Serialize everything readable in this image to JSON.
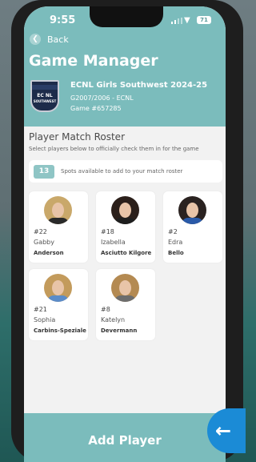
{
  "status": {
    "time": "9:55",
    "battery": "71"
  },
  "nav": {
    "back_label": "Back"
  },
  "page": {
    "title": "Game Manager"
  },
  "game": {
    "name": "ECNL Girls Southwest 2024-25",
    "division": "G2007/2006 - ECNL",
    "number": "Game #657285",
    "crest_text": "EC SOUTHWEST"
  },
  "roster": {
    "title": "Player Match Roster",
    "subtitle": "Select players below to officially check them in for the game",
    "spots_count": "13",
    "spots_text": "Spots available to add to your match roster"
  },
  "players": [
    {
      "number": "#22",
      "first": "Gabby",
      "last": "Anderson",
      "hair": "#c9a86a",
      "shirt": "#2a2a2a"
    },
    {
      "number": "#18",
      "first": "Izabella",
      "last": "Asciutto Kilgore",
      "hair": "#2b1f1a",
      "shirt": "#1e1e1e"
    },
    {
      "number": "#2",
      "first": "Edra",
      "last": "Bello",
      "hair": "#2a2220",
      "shirt": "#2a5aa8"
    },
    {
      "number": "#21",
      "first": "Sophia",
      "last": "Carbins-Speziale",
      "hair": "#c39b5c",
      "shirt": "#5b8cc9"
    },
    {
      "number": "#8",
      "first": "Katelyn",
      "last": "Devermann",
      "hair": "#b48a52",
      "shirt": "#6d6d6d"
    }
  ],
  "footer": {
    "add_label": "Add Player",
    "back_icon": "arrow-left-icon"
  },
  "colors": {
    "accent": "#7bbcbc",
    "fab": "#1b8bd6"
  }
}
